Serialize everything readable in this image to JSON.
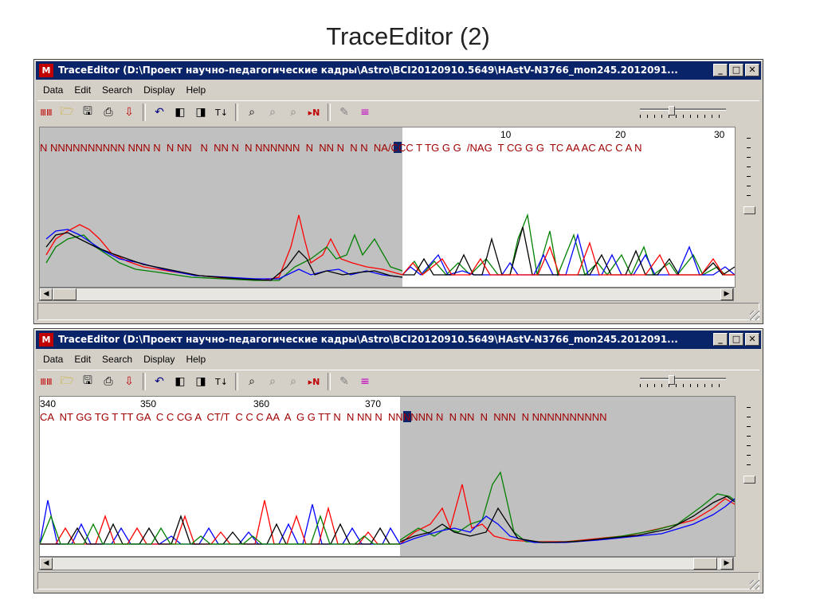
{
  "slide": {
    "title": "TraceEditor (2)"
  },
  "windows": [
    {
      "title": "TraceEditor (D:\\Проект научно-педагогические кадры\\Astro\\BCI20120910.5649\\HAstV-N3766_mon245.2012091...",
      "menu": [
        "Data",
        "Edit",
        "Search",
        "Display",
        "Help"
      ],
      "positions": [
        "10",
        "20",
        "30"
      ],
      "sequence": "N NNNNNNNNNN NNN N  N NN   N  NN N  N NNNNNN  N  NN N  N N  NA/CCC T TG G G  /NAG  T CG G G  TC AA AC AC C A N"
    },
    {
      "title": "TraceEditor (D:\\Проект научно-педагогические кадры\\Astro\\BCI20120910.5649\\HAstV-N3766_mon245.2012091...",
      "menu": [
        "Data",
        "Edit",
        "Search",
        "Display",
        "Help"
      ],
      "positions": [
        "340",
        "350",
        "360",
        "370"
      ],
      "sequence": "CA  NT GG TG T TT GA  C C CG A  CT/T  C C C AA  A  G G TT N  N NN N  NNNNNN N  N NN  N  NNN  N NNNNNNNNNN"
    }
  ],
  "toolbar_icons": [
    "abi-icon",
    "open-folder-icon",
    "save-icon",
    "print-icon",
    "download-icon",
    "undo-icon",
    "left-clip-icon",
    "right-clip-icon",
    "reverse-icon",
    "find-icon",
    "find-next-icon",
    "find-prev-icon",
    "next-n-icon",
    "edit-icon",
    "color-icon"
  ],
  "menu_labels": {
    "data": "Data",
    "edit": "Edit",
    "search": "Search",
    "display": "Display",
    "help": "Help"
  },
  "colors": {
    "A": "#008000",
    "C": "#0000ff",
    "G": "#000000",
    "T": "#ff0000",
    "N": "#a00000",
    "titlebar": "#0a246a",
    "grey_region": "#c0c0c0"
  }
}
